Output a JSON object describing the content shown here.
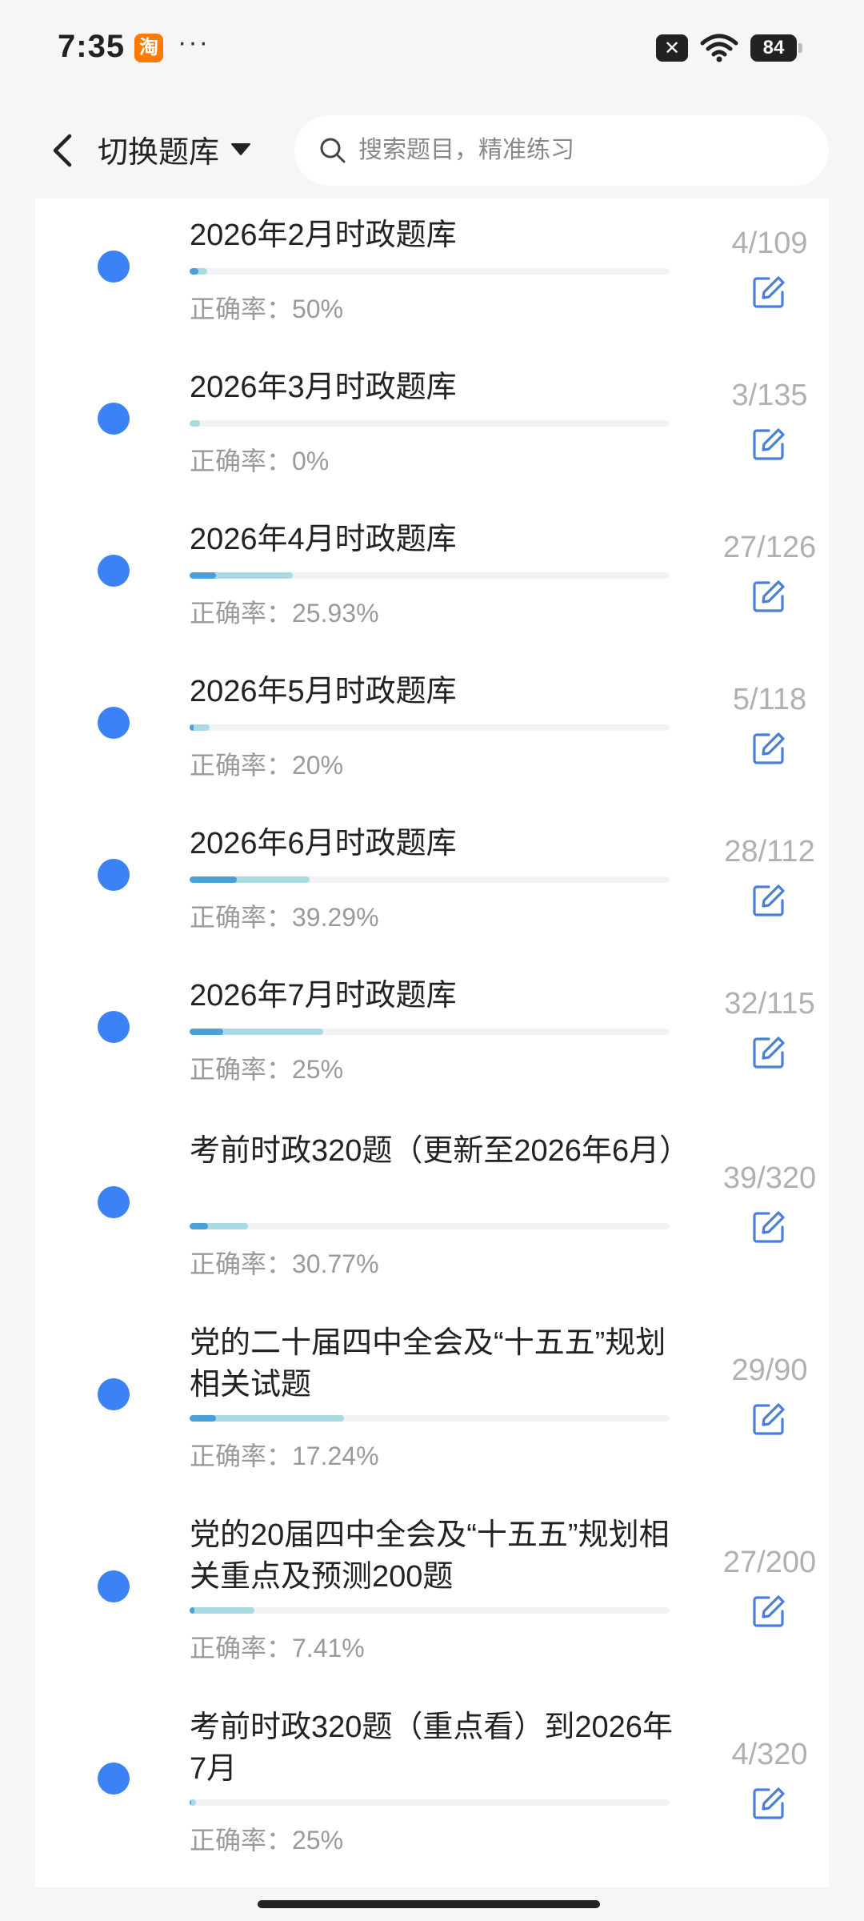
{
  "status_bar": {
    "time": "7:35",
    "app_badge": "淘",
    "more": "···",
    "battery": "84"
  },
  "header": {
    "switch_label": "切换题库",
    "search_placeholder": "搜索题目，精准练习"
  },
  "items": [
    {
      "title": "2026年2月时政题库",
      "accuracy": "正确率：50%",
      "count": "4/109",
      "done_ratio": 0.0367,
      "correct_ratio": 0.0183
    },
    {
      "title": "2026年3月时政题库",
      "accuracy": "正确率：0%",
      "count": "3/135",
      "done_ratio": 0.0222,
      "correct_ratio": 0
    },
    {
      "title": "2026年4月时政题库",
      "accuracy": "正确率：25.93%",
      "count": "27/126",
      "done_ratio": 0.2143,
      "correct_ratio": 0.0556
    },
    {
      "title": "2026年5月时政题库",
      "accuracy": "正确率：20%",
      "count": "5/118",
      "done_ratio": 0.0424,
      "correct_ratio": 0.0085
    },
    {
      "title": "2026年6月时政题库",
      "accuracy": "正确率：39.29%",
      "count": "28/112",
      "done_ratio": 0.25,
      "correct_ratio": 0.0982
    },
    {
      "title": "2026年7月时政题库",
      "accuracy": "正确率：25%",
      "count": "32/115",
      "done_ratio": 0.2783,
      "correct_ratio": 0.0696
    },
    {
      "title": "考前时政320题（更新至2026年6月）",
      "accuracy": "正确率：30.77%",
      "count": "39/320",
      "done_ratio": 0.1219,
      "correct_ratio": 0.0375
    },
    {
      "title": "党的二十届四中全会及“十五五”规划相关试题",
      "accuracy": "正确率：17.24%",
      "count": "29/90",
      "done_ratio": 0.3222,
      "correct_ratio": 0.0556
    },
    {
      "title": "党的20届四中全会及“十五五”规划相关重点及预测200题",
      "accuracy": "正确率：7.41%",
      "count": "27/200",
      "done_ratio": 0.135,
      "correct_ratio": 0.01
    },
    {
      "title": "考前时政320题（重点看）到2026年7月",
      "accuracy": "正确率：25%",
      "count": "4/320",
      "done_ratio": 0.0125,
      "correct_ratio": 0.0031
    }
  ]
}
